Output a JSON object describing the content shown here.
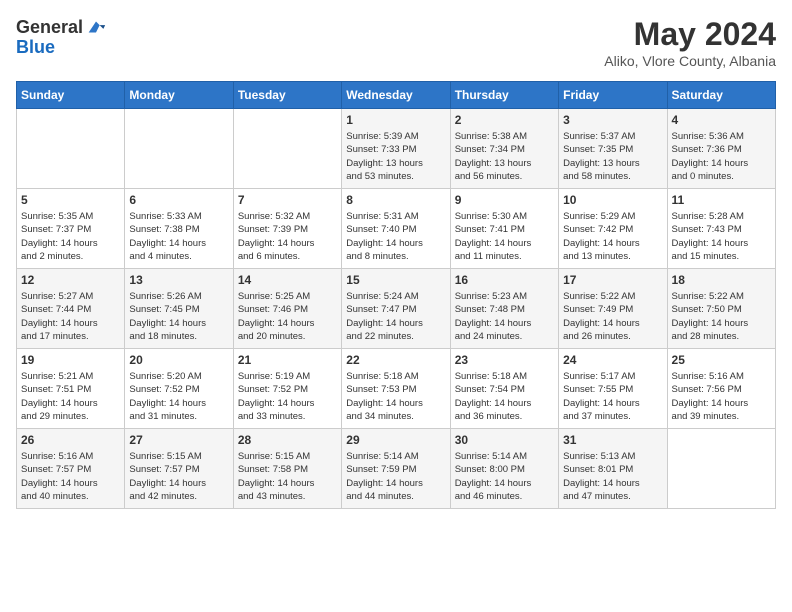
{
  "logo": {
    "general": "General",
    "blue": "Blue"
  },
  "title": {
    "month": "May 2024",
    "location": "Aliko, Vlore County, Albania"
  },
  "headers": [
    "Sunday",
    "Monday",
    "Tuesday",
    "Wednesday",
    "Thursday",
    "Friday",
    "Saturday"
  ],
  "weeks": [
    [
      {
        "day": "",
        "info": ""
      },
      {
        "day": "",
        "info": ""
      },
      {
        "day": "",
        "info": ""
      },
      {
        "day": "1",
        "info": "Sunrise: 5:39 AM\nSunset: 7:33 PM\nDaylight: 13 hours\nand 53 minutes."
      },
      {
        "day": "2",
        "info": "Sunrise: 5:38 AM\nSunset: 7:34 PM\nDaylight: 13 hours\nand 56 minutes."
      },
      {
        "day": "3",
        "info": "Sunrise: 5:37 AM\nSunset: 7:35 PM\nDaylight: 13 hours\nand 58 minutes."
      },
      {
        "day": "4",
        "info": "Sunrise: 5:36 AM\nSunset: 7:36 PM\nDaylight: 14 hours\nand 0 minutes."
      }
    ],
    [
      {
        "day": "5",
        "info": "Sunrise: 5:35 AM\nSunset: 7:37 PM\nDaylight: 14 hours\nand 2 minutes."
      },
      {
        "day": "6",
        "info": "Sunrise: 5:33 AM\nSunset: 7:38 PM\nDaylight: 14 hours\nand 4 minutes."
      },
      {
        "day": "7",
        "info": "Sunrise: 5:32 AM\nSunset: 7:39 PM\nDaylight: 14 hours\nand 6 minutes."
      },
      {
        "day": "8",
        "info": "Sunrise: 5:31 AM\nSunset: 7:40 PM\nDaylight: 14 hours\nand 8 minutes."
      },
      {
        "day": "9",
        "info": "Sunrise: 5:30 AM\nSunset: 7:41 PM\nDaylight: 14 hours\nand 11 minutes."
      },
      {
        "day": "10",
        "info": "Sunrise: 5:29 AM\nSunset: 7:42 PM\nDaylight: 14 hours\nand 13 minutes."
      },
      {
        "day": "11",
        "info": "Sunrise: 5:28 AM\nSunset: 7:43 PM\nDaylight: 14 hours\nand 15 minutes."
      }
    ],
    [
      {
        "day": "12",
        "info": "Sunrise: 5:27 AM\nSunset: 7:44 PM\nDaylight: 14 hours\nand 17 minutes."
      },
      {
        "day": "13",
        "info": "Sunrise: 5:26 AM\nSunset: 7:45 PM\nDaylight: 14 hours\nand 18 minutes."
      },
      {
        "day": "14",
        "info": "Sunrise: 5:25 AM\nSunset: 7:46 PM\nDaylight: 14 hours\nand 20 minutes."
      },
      {
        "day": "15",
        "info": "Sunrise: 5:24 AM\nSunset: 7:47 PM\nDaylight: 14 hours\nand 22 minutes."
      },
      {
        "day": "16",
        "info": "Sunrise: 5:23 AM\nSunset: 7:48 PM\nDaylight: 14 hours\nand 24 minutes."
      },
      {
        "day": "17",
        "info": "Sunrise: 5:22 AM\nSunset: 7:49 PM\nDaylight: 14 hours\nand 26 minutes."
      },
      {
        "day": "18",
        "info": "Sunrise: 5:22 AM\nSunset: 7:50 PM\nDaylight: 14 hours\nand 28 minutes."
      }
    ],
    [
      {
        "day": "19",
        "info": "Sunrise: 5:21 AM\nSunset: 7:51 PM\nDaylight: 14 hours\nand 29 minutes."
      },
      {
        "day": "20",
        "info": "Sunrise: 5:20 AM\nSunset: 7:52 PM\nDaylight: 14 hours\nand 31 minutes."
      },
      {
        "day": "21",
        "info": "Sunrise: 5:19 AM\nSunset: 7:52 PM\nDaylight: 14 hours\nand 33 minutes."
      },
      {
        "day": "22",
        "info": "Sunrise: 5:18 AM\nSunset: 7:53 PM\nDaylight: 14 hours\nand 34 minutes."
      },
      {
        "day": "23",
        "info": "Sunrise: 5:18 AM\nSunset: 7:54 PM\nDaylight: 14 hours\nand 36 minutes."
      },
      {
        "day": "24",
        "info": "Sunrise: 5:17 AM\nSunset: 7:55 PM\nDaylight: 14 hours\nand 37 minutes."
      },
      {
        "day": "25",
        "info": "Sunrise: 5:16 AM\nSunset: 7:56 PM\nDaylight: 14 hours\nand 39 minutes."
      }
    ],
    [
      {
        "day": "26",
        "info": "Sunrise: 5:16 AM\nSunset: 7:57 PM\nDaylight: 14 hours\nand 40 minutes."
      },
      {
        "day": "27",
        "info": "Sunrise: 5:15 AM\nSunset: 7:57 PM\nDaylight: 14 hours\nand 42 minutes."
      },
      {
        "day": "28",
        "info": "Sunrise: 5:15 AM\nSunset: 7:58 PM\nDaylight: 14 hours\nand 43 minutes."
      },
      {
        "day": "29",
        "info": "Sunrise: 5:14 AM\nSunset: 7:59 PM\nDaylight: 14 hours\nand 44 minutes."
      },
      {
        "day": "30",
        "info": "Sunrise: 5:14 AM\nSunset: 8:00 PM\nDaylight: 14 hours\nand 46 minutes."
      },
      {
        "day": "31",
        "info": "Sunrise: 5:13 AM\nSunset: 8:01 PM\nDaylight: 14 hours\nand 47 minutes."
      },
      {
        "day": "",
        "info": ""
      }
    ]
  ]
}
